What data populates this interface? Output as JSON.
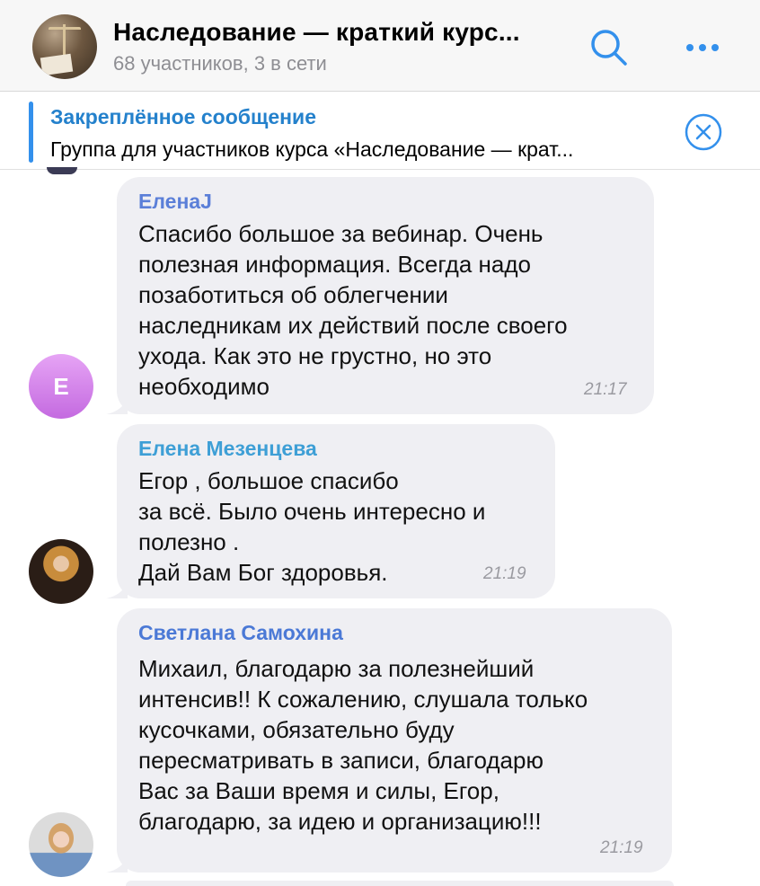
{
  "header": {
    "title": "Наследование — краткий курс...",
    "subtitle": "68 участников, 3 в сети",
    "search_icon": "search-icon",
    "more_icon": "more-icon",
    "accent": "#3390ec"
  },
  "pinned": {
    "title": "Закреплённое сообщение",
    "text": "Группа для участников курса «Наследование — крат...",
    "close_icon": "close-circle-icon"
  },
  "messages": [
    {
      "author": "ЕленаJ",
      "author_color": "#5b7fd8",
      "lines": [
        "Спасибо большое за вебинар. Очень",
        "полезная информация. Всегда надо",
        "позаботиться об облегчении",
        "наследникам их действий после своего",
        "ухода. Как это не грустно, но это",
        "необходимо"
      ],
      "time": "21:17",
      "avatar_letter": "E"
    },
    {
      "author": "Елена Мезенцева",
      "author_color": "#3e9fd6",
      "lines": [
        "Егор , большое спасибо",
        "за всё. Было очень интересно и",
        "полезно .",
        "Дай Вам Бог здоровья."
      ],
      "time": "21:19"
    },
    {
      "author": "Светлана Самохина",
      "author_color": "#4b79d6",
      "lines": [
        "Михаил, благодарю за полезнейший",
        "интенсив!! К сожалению, слушала только",
        "кусочками, обязательно буду",
        "пересматривать в записи, благодарю",
        "Вас за Ваши время и силы, Егор,",
        "благодарю, за идею и организацию!!!"
      ],
      "time": "21:19"
    }
  ]
}
